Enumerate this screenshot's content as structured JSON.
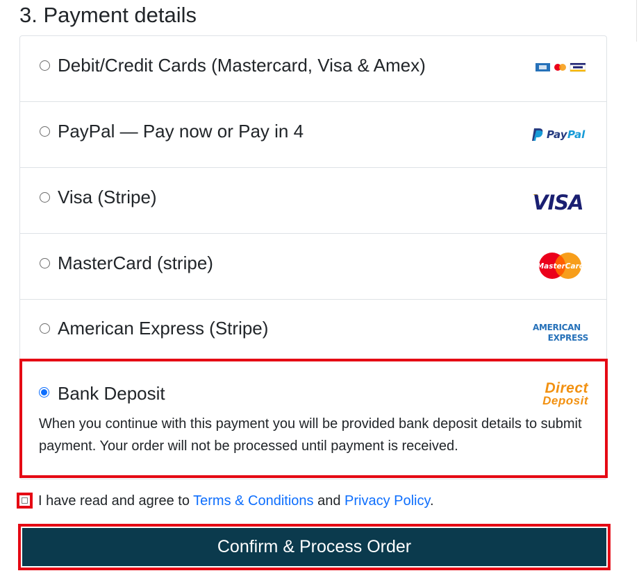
{
  "section": {
    "title": "3. Payment details"
  },
  "methods": [
    {
      "label": "Debit/Credit Cards (Mastercard, Visa & Amex)",
      "logo": "card-brands-icon",
      "selected": false
    },
    {
      "label": "PayPal — Pay now or Pay in 4",
      "logo": "paypal-logo",
      "logo_text": "PayPal",
      "selected": false
    },
    {
      "label": "Visa (Stripe)",
      "logo": "visa-logo",
      "logo_text": "VISA",
      "selected": false
    },
    {
      "label": "MasterCard (stripe)",
      "logo": "mastercard-logo",
      "logo_text": "MasterCard",
      "selected": false
    },
    {
      "label": "American Express (Stripe)",
      "logo": "amex-logo",
      "logo_text_line1": "AMERICAN",
      "logo_text_line2": "EXPRESS",
      "selected": false
    }
  ],
  "bank_deposit": {
    "label": "Bank Deposit",
    "selected": true,
    "logo_line1": "Direct",
    "logo_line2": "Deposit",
    "description": "When you continue with this payment you will be provided bank deposit details to submit payment. Your order will not be processed until payment is received."
  },
  "terms": {
    "prefix": "I have read and agree to ",
    "terms_link": "Terms & Conditions",
    "middle": " and ",
    "privacy_link": "Privacy Policy",
    "suffix": "."
  },
  "confirm": {
    "label": "Confirm & Process Order"
  },
  "colors": {
    "accent_blue": "#0d6efd",
    "button_bg": "#0b3a4d",
    "highlight_red": "#e50914",
    "direct_deposit_orange": "#f29111",
    "paypal_dark": "#253b80",
    "paypal_light": "#179bd7",
    "visa_blue": "#1a1f71",
    "visa_gold": "#f7b600",
    "amex_blue": "#2671b9"
  }
}
